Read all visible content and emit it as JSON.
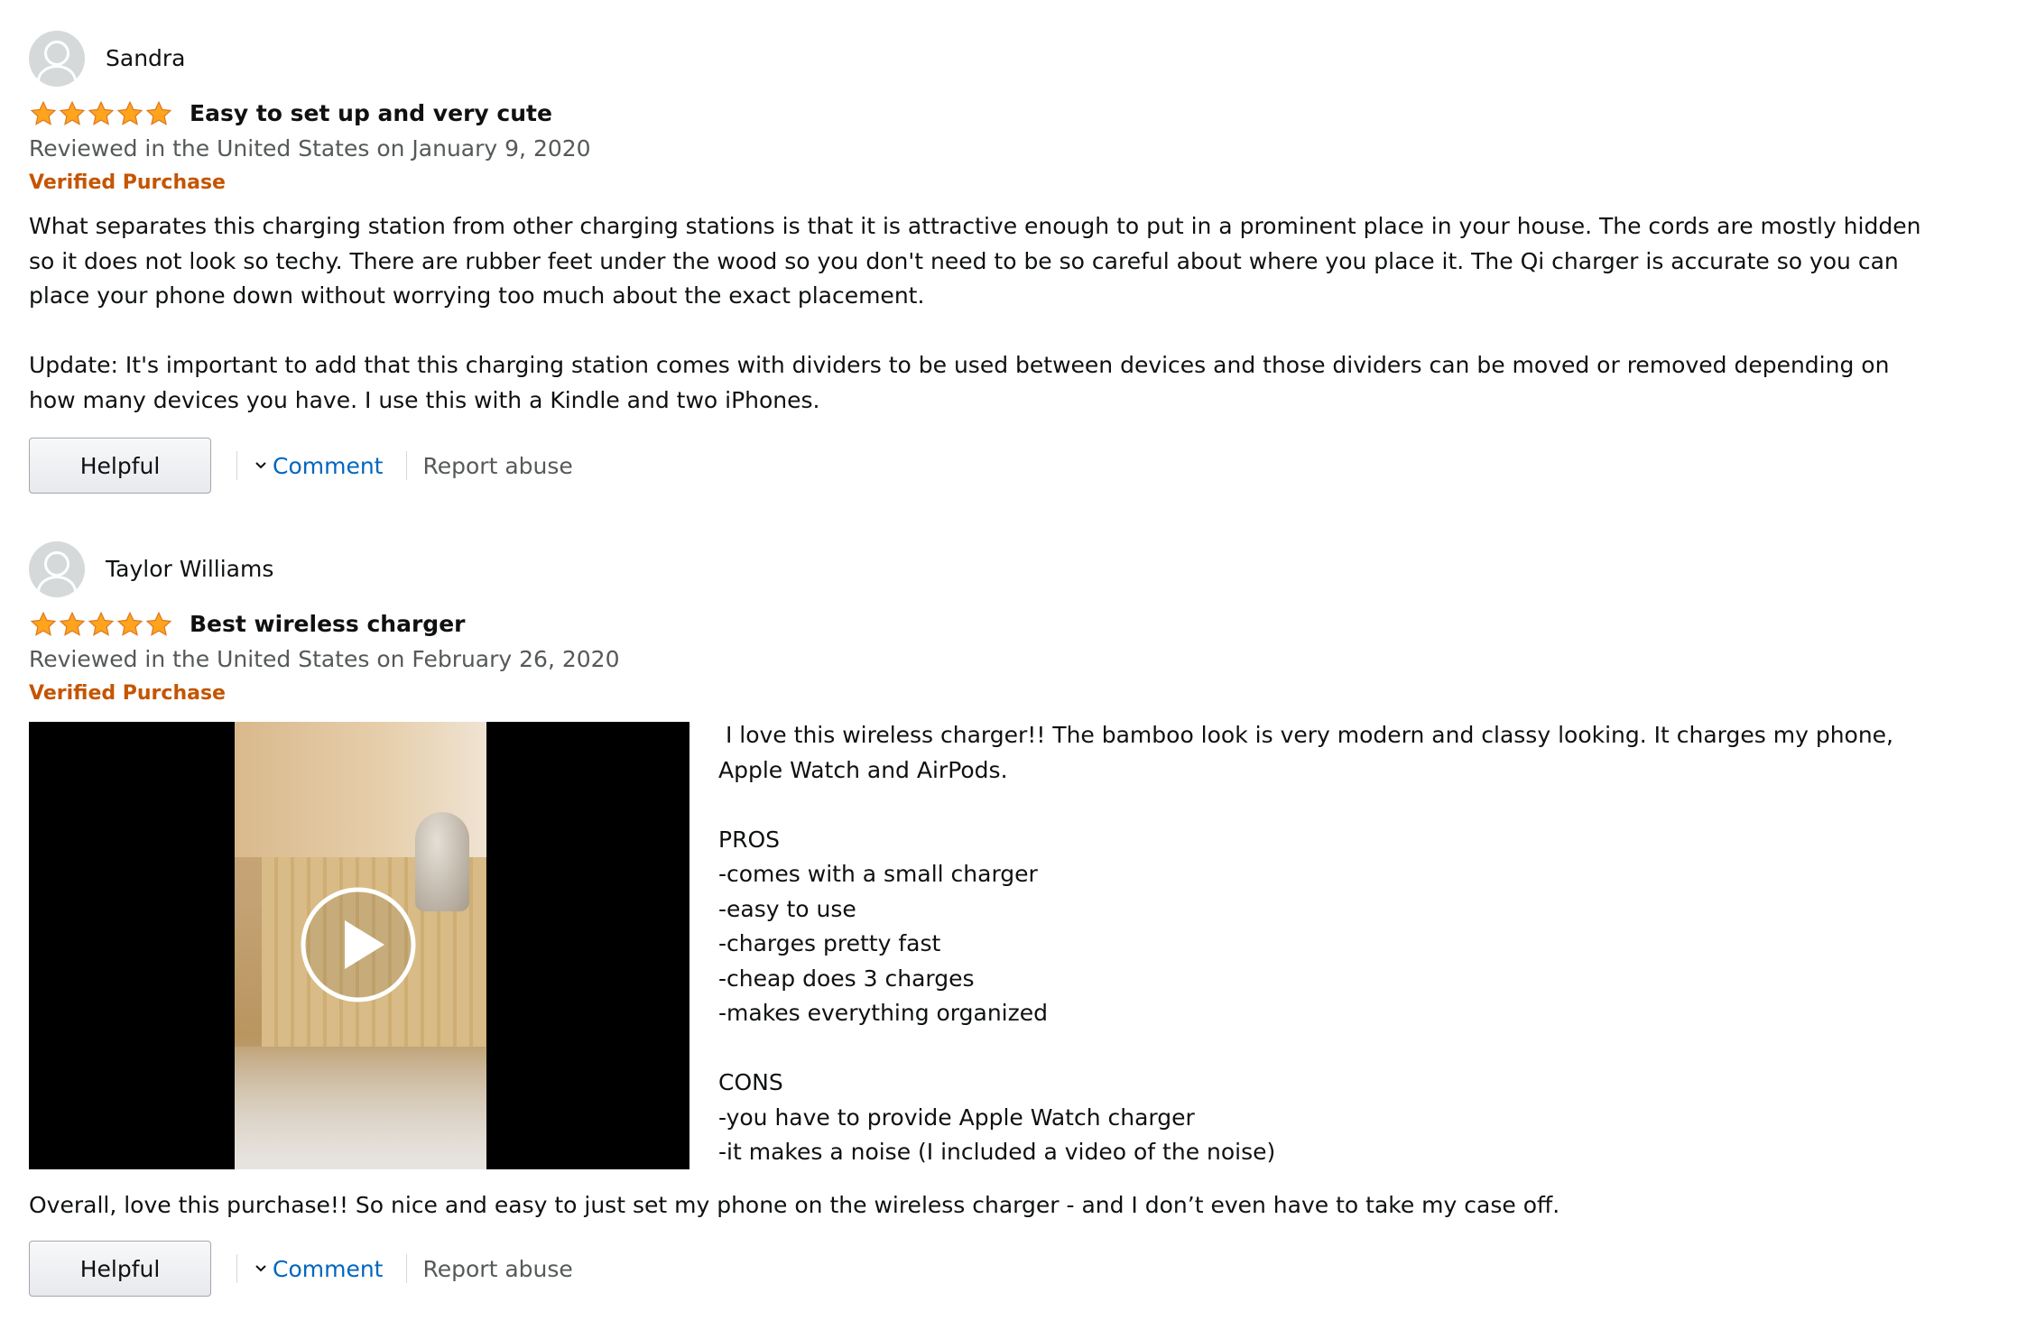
{
  "reviews": [
    {
      "reviewer": "Sandra",
      "rating": 5,
      "rating_max": 5,
      "title": "Easy to set up and very cute",
      "date": "Reviewed in the United States on January 9, 2020",
      "verified": "Verified Purchase",
      "body": [
        "What separates this charging station from other charging stations is that it is attractive enough to put in a prominent place in your house. The cords are mostly hidden so it does not look so techy. There are rubber feet under the wood so you don't need to be so careful about where you place it. The Qi charger is accurate so you can place your phone down without worrying too much about the exact placement.",
        "Update: It's important to add that this charging station comes with dividers to be used between devices and those dividers can be moved or removed depending on how many devices you have. I use this with a Kindle and two iPhones."
      ],
      "actions": {
        "helpful": "Helpful",
        "comment": "Comment",
        "report": "Report abuse"
      }
    },
    {
      "reviewer": "Taylor Williams",
      "rating": 5,
      "rating_max": 5,
      "title": "Best wireless charger",
      "date": "Reviewed in the United States on February 26, 2020",
      "verified": "Verified Purchase",
      "media_text": [
        " I love this wireless charger!! The bamboo look is very modern and classy looking. It charges my phone, Apple Watch and AirPods.",
        "",
        "PROS",
        "-comes with a small charger",
        "-easy to use",
        "-charges pretty fast",
        "-cheap does 3 charges",
        "-makes everything organized",
        "",
        "CONS",
        "-you have to provide Apple Watch charger",
        "-it makes a noise (I included a video of the noise)"
      ],
      "after_media": "Overall, love this purchase!! So nice and easy to just set my phone on the wireless charger - and I don’t even have to take my case off.",
      "actions": {
        "helpful": "Helpful",
        "comment": "Comment",
        "report": "Report abuse"
      }
    }
  ],
  "colors": {
    "verified": "#c45500",
    "date": "#565959",
    "link": "#0066c0",
    "star": "#ffa41c"
  },
  "icons": {
    "avatar": "default-profile-avatar-icon",
    "star": "star-icon",
    "chevron": "chevron-down-icon",
    "play": "play-icon"
  }
}
